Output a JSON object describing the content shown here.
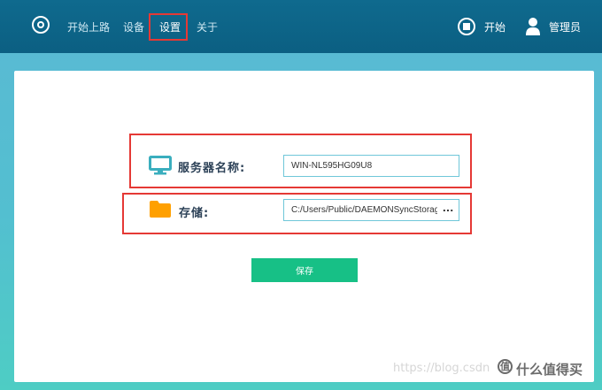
{
  "topbar": {
    "nav": [
      {
        "label": "开始上路"
      },
      {
        "label": "设备"
      },
      {
        "label": "设置"
      },
      {
        "label": "关于"
      }
    ],
    "start_label": "开始",
    "user_label": "管理员"
  },
  "form": {
    "server_name_label": "服务器名称:",
    "server_name_value": "WIN-NL595HG09U8",
    "storage_label": "存储:",
    "storage_value": "C:/Users/Public/DAEMONSyncStorage",
    "browse_label": "...",
    "save_label": "保存"
  },
  "watermark": {
    "url_text": "https://blog.csdn",
    "brand_text": "什么值得买"
  },
  "colors": {
    "topbar": "#0b5f82",
    "accent_teal": "#3aaebe",
    "folder": "#ffa000",
    "save_button": "#17c086",
    "highlight": "#e53935"
  },
  "icons": {
    "logo": "ring-logo-icon",
    "start": "stop-circle-icon",
    "user": "user-icon",
    "server": "monitor-icon",
    "storage": "folder-icon"
  }
}
